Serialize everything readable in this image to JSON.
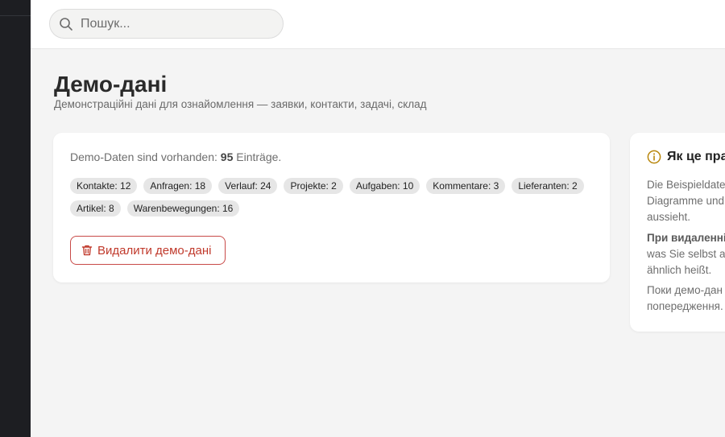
{
  "search": {
    "placeholder": "Пошук..."
  },
  "page": {
    "title": "Демо-дані",
    "subtitle": "Демонстраційні дані для ознайомлення — заявки, контакти, задачі, склад"
  },
  "demo_card": {
    "status_prefix": "Demo-Daten sind vorhanden:",
    "status_count": "95",
    "status_suffix": "Einträge.",
    "chips": [
      "Kontakte: 12",
      "Anfragen: 18",
      "Verlauf: 24",
      "Projekte: 2",
      "Aufgaben: 10",
      "Kommentare: 3",
      "Lieferanten: 2",
      "Artikel: 8",
      "Warenbewegungen: 16"
    ],
    "delete_label": "Видалити демо-дані"
  },
  "info_card": {
    "title": "Як це пра",
    "p1_lines": [
      "Die Beispieldate",
      "Diagramme und",
      "aussieht."
    ],
    "p2_bold": "При видаленні",
    "p2_lines": [
      "was Sie selbst a",
      "ähnlich heißt."
    ],
    "p3_lines": [
      "Поки демо-дан",
      "попередження."
    ]
  },
  "colors": {
    "sidebar": "#1d1e22",
    "accent_danger": "#c0392b",
    "info_icon": "#b8860b"
  }
}
